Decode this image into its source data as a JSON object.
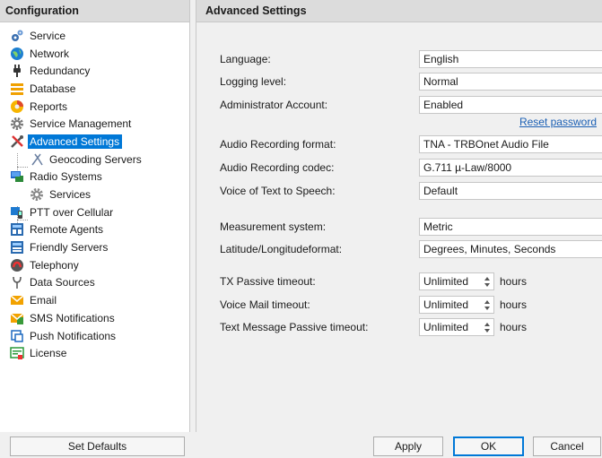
{
  "left_pane": {
    "title": "Configuration",
    "items": [
      {
        "label": "Service",
        "icon": "gears-icon",
        "level": 0
      },
      {
        "label": "Network",
        "icon": "globe-icon",
        "level": 0
      },
      {
        "label": "Redundancy",
        "icon": "plug-icon",
        "level": 0
      },
      {
        "label": "Database",
        "icon": "database-icon",
        "level": 0
      },
      {
        "label": "Reports",
        "icon": "reports-icon",
        "level": 0
      },
      {
        "label": "Service Management",
        "icon": "gear-icon",
        "level": 0
      },
      {
        "label": "Advanced Settings",
        "icon": "tools-icon",
        "level": 0,
        "selected": true
      },
      {
        "label": "Geocoding Servers",
        "icon": "geocoding-icon",
        "level": 1
      },
      {
        "label": "Radio Systems",
        "icon": "radio-systems-icon",
        "level": 0
      },
      {
        "label": "Services",
        "icon": "gear-icon",
        "level": 1
      },
      {
        "label": "PTT over Cellular",
        "icon": "ptt-icon",
        "level": 0
      },
      {
        "label": "Remote Agents",
        "icon": "remote-agents-icon",
        "level": 0
      },
      {
        "label": "Friendly Servers",
        "icon": "friendly-servers-icon",
        "level": 0
      },
      {
        "label": "Telephony",
        "icon": "telephone-icon",
        "level": 0
      },
      {
        "label": "Data Sources",
        "icon": "data-sources-icon",
        "level": 0
      },
      {
        "label": "Email",
        "icon": "email-icon",
        "level": 0
      },
      {
        "label": "SMS Notifications",
        "icon": "sms-icon",
        "level": 0
      },
      {
        "label": "Push Notifications",
        "icon": "push-icon",
        "level": 0
      },
      {
        "label": "License",
        "icon": "license-icon",
        "level": 0
      }
    ]
  },
  "right_pane": {
    "title": "Advanced Settings",
    "language": {
      "label": "Language:",
      "value": "English"
    },
    "logging_level": {
      "label": "Logging level:",
      "value": "Normal"
    },
    "admin_account": {
      "label": "Administrator Account:",
      "value": "Enabled"
    },
    "reset_password": "Reset password",
    "audio_format": {
      "label": "Audio Recording format:",
      "value": "TNA - TRBOnet Audio File"
    },
    "audio_codec": {
      "label": "Audio Recording codec:",
      "value": "G.711 µ-Law/8000"
    },
    "tts_voice": {
      "label": "Voice of Text to Speech:",
      "value": "Default"
    },
    "measurement": {
      "label": "Measurement system:",
      "value": "Metric"
    },
    "latlon": {
      "label": "Latitude/Longitudeformat:",
      "value": "Degrees, Minutes, Seconds"
    },
    "tx_timeout": {
      "label": "TX Passive timeout:",
      "value": "Unlimited",
      "unit": "hours"
    },
    "vm_timeout": {
      "label": "Voice Mail timeout:",
      "value": "Unlimited",
      "unit": "hours"
    },
    "tm_timeout": {
      "label": "Text Message Passive timeout:",
      "value": "Unlimited",
      "unit": "hours"
    }
  },
  "buttons": {
    "set_defaults": "Set Defaults",
    "apply": "Apply",
    "ok": "OK",
    "cancel": "Cancel"
  }
}
